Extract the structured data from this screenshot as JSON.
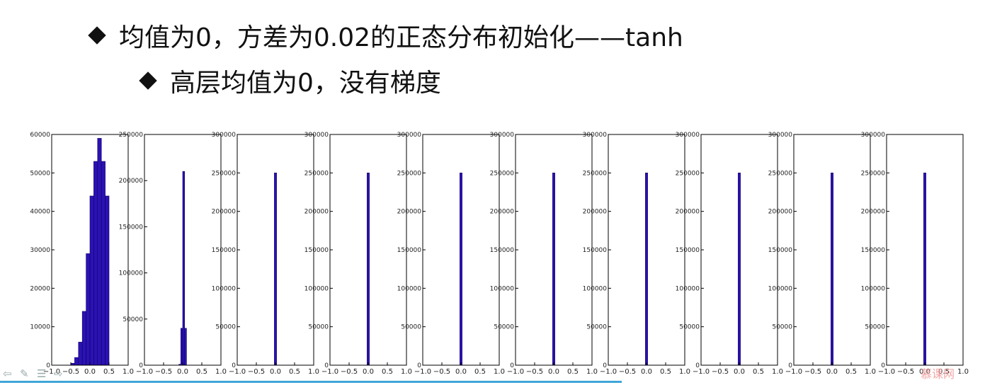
{
  "slide": {
    "bullet1": "均值为0，方差为0.02的正态分布初始化——tanh",
    "bullet2": "高层均值为0，没有梯度"
  },
  "watermark": "慕课网",
  "colors": {
    "bar": "#2a12b4",
    "axis": "#000000",
    "progress": "#3fa6d8"
  },
  "nav_icons": [
    "back-arrow-icon",
    "pen-icon",
    "menu-icon",
    "forward-arrow-icon"
  ],
  "chart_data": [
    {
      "type": "bar",
      "xlim": [
        -1.0,
        1.0
      ],
      "xticks": [
        "−1.0",
        "−0.5",
        "0.0",
        "0.5",
        "1.0"
      ],
      "ylim": [
        0,
        60000
      ],
      "yticks": [
        "0",
        "10000",
        "20000",
        "30000",
        "40000",
        "50000",
        "60000"
      ],
      "bar_width": 0.1,
      "x": [
        -0.45,
        -0.35,
        -0.25,
        -0.15,
        -0.05,
        0.05,
        0.15,
        0.25,
        0.35,
        0.45
      ],
      "values": [
        500,
        2000,
        6000,
        14000,
        29000,
        44000,
        53000,
        59000,
        53000,
        44000
      ]
    },
    {
      "type": "bar",
      "xlim": [
        -1.0,
        1.0
      ],
      "xticks": [
        "−1.0",
        "−0.5",
        "0.0",
        "0.5",
        "1.0"
      ],
      "ylim": [
        0,
        250000
      ],
      "yticks": [
        "0",
        "50000",
        "100000",
        "150000",
        "200000",
        "250000"
      ],
      "bar_width": 0.05,
      "x": [
        -0.075,
        -0.025,
        0.025,
        0.075
      ],
      "values": [
        1000,
        40000,
        210000,
        40000
      ]
    },
    {
      "type": "bar",
      "xlim": [
        -1.0,
        1.0
      ],
      "xticks": [
        "−1.0",
        "−0.5",
        "0.0",
        "0.5",
        "1.0"
      ],
      "ylim": [
        0,
        300000
      ],
      "yticks": [
        "0",
        "50000",
        "100000",
        "150000",
        "200000",
        "250000",
        "300000"
      ],
      "bar_width": 0.06,
      "x": [
        0.0
      ],
      "values": [
        250000
      ]
    },
    {
      "type": "bar",
      "xlim": [
        -1.0,
        1.0
      ],
      "xticks": [
        "−1.0",
        "−0.5",
        "0.0",
        "0.5",
        "1.0"
      ],
      "ylim": [
        0,
        300000
      ],
      "yticks": [
        "0",
        "50000",
        "100000",
        "150000",
        "200000",
        "250000",
        "300000"
      ],
      "bar_width": 0.06,
      "x": [
        0.0
      ],
      "values": [
        250000
      ]
    },
    {
      "type": "bar",
      "xlim": [
        -1.0,
        1.0
      ],
      "xticks": [
        "−1.0",
        "−0.5",
        "0.0",
        "0.5",
        "1.0"
      ],
      "ylim": [
        0,
        300000
      ],
      "yticks": [
        "0",
        "50000",
        "100000",
        "150000",
        "200000",
        "250000",
        "300000"
      ],
      "bar_width": 0.06,
      "x": [
        0.0
      ],
      "values": [
        250000
      ]
    },
    {
      "type": "bar",
      "xlim": [
        -1.0,
        1.0
      ],
      "xticks": [
        "−1.0",
        "−0.5",
        "0.0",
        "0.5",
        "1.0"
      ],
      "ylim": [
        0,
        300000
      ],
      "yticks": [
        "0",
        "50000",
        "100000",
        "150000",
        "200000",
        "250000",
        "300000"
      ],
      "bar_width": 0.06,
      "x": [
        0.0
      ],
      "values": [
        250000
      ]
    },
    {
      "type": "bar",
      "xlim": [
        -1.0,
        1.0
      ],
      "xticks": [
        "−1.0",
        "−0.5",
        "0.0",
        "0.5",
        "1.0"
      ],
      "ylim": [
        0,
        300000
      ],
      "yticks": [
        "0",
        "50000",
        "100000",
        "150000",
        "200000",
        "250000",
        "300000"
      ],
      "bar_width": 0.06,
      "x": [
        0.0
      ],
      "values": [
        250000
      ]
    },
    {
      "type": "bar",
      "xlim": [
        -1.0,
        1.0
      ],
      "xticks": [
        "−1.0",
        "−0.5",
        "0.0",
        "0.5",
        "1.0"
      ],
      "ylim": [
        0,
        300000
      ],
      "yticks": [
        "0",
        "50000",
        "100000",
        "150000",
        "200000",
        "250000",
        "300000"
      ],
      "bar_width": 0.06,
      "x": [
        0.0
      ],
      "values": [
        250000
      ]
    },
    {
      "type": "bar",
      "xlim": [
        -1.0,
        1.0
      ],
      "xticks": [
        "−1.0",
        "−0.5",
        "0.0",
        "0.5",
        "1.0"
      ],
      "ylim": [
        0,
        300000
      ],
      "yticks": [
        "0",
        "50000",
        "100000",
        "150000",
        "200000",
        "250000",
        "300000"
      ],
      "bar_width": 0.06,
      "x": [
        0.0
      ],
      "values": [
        250000
      ]
    },
    {
      "type": "bar",
      "xlim": [
        -1.0,
        1.0
      ],
      "xticks": [
        "−1.0",
        "−0.5",
        "0.0",
        "0.5",
        "1.0"
      ],
      "ylim": [
        0,
        300000
      ],
      "yticks": [
        "0",
        "50000",
        "100000",
        "150000",
        "200000",
        "250000",
        "300000"
      ],
      "bar_width": 0.06,
      "x": [
        0.0
      ],
      "values": [
        250000
      ]
    }
  ]
}
